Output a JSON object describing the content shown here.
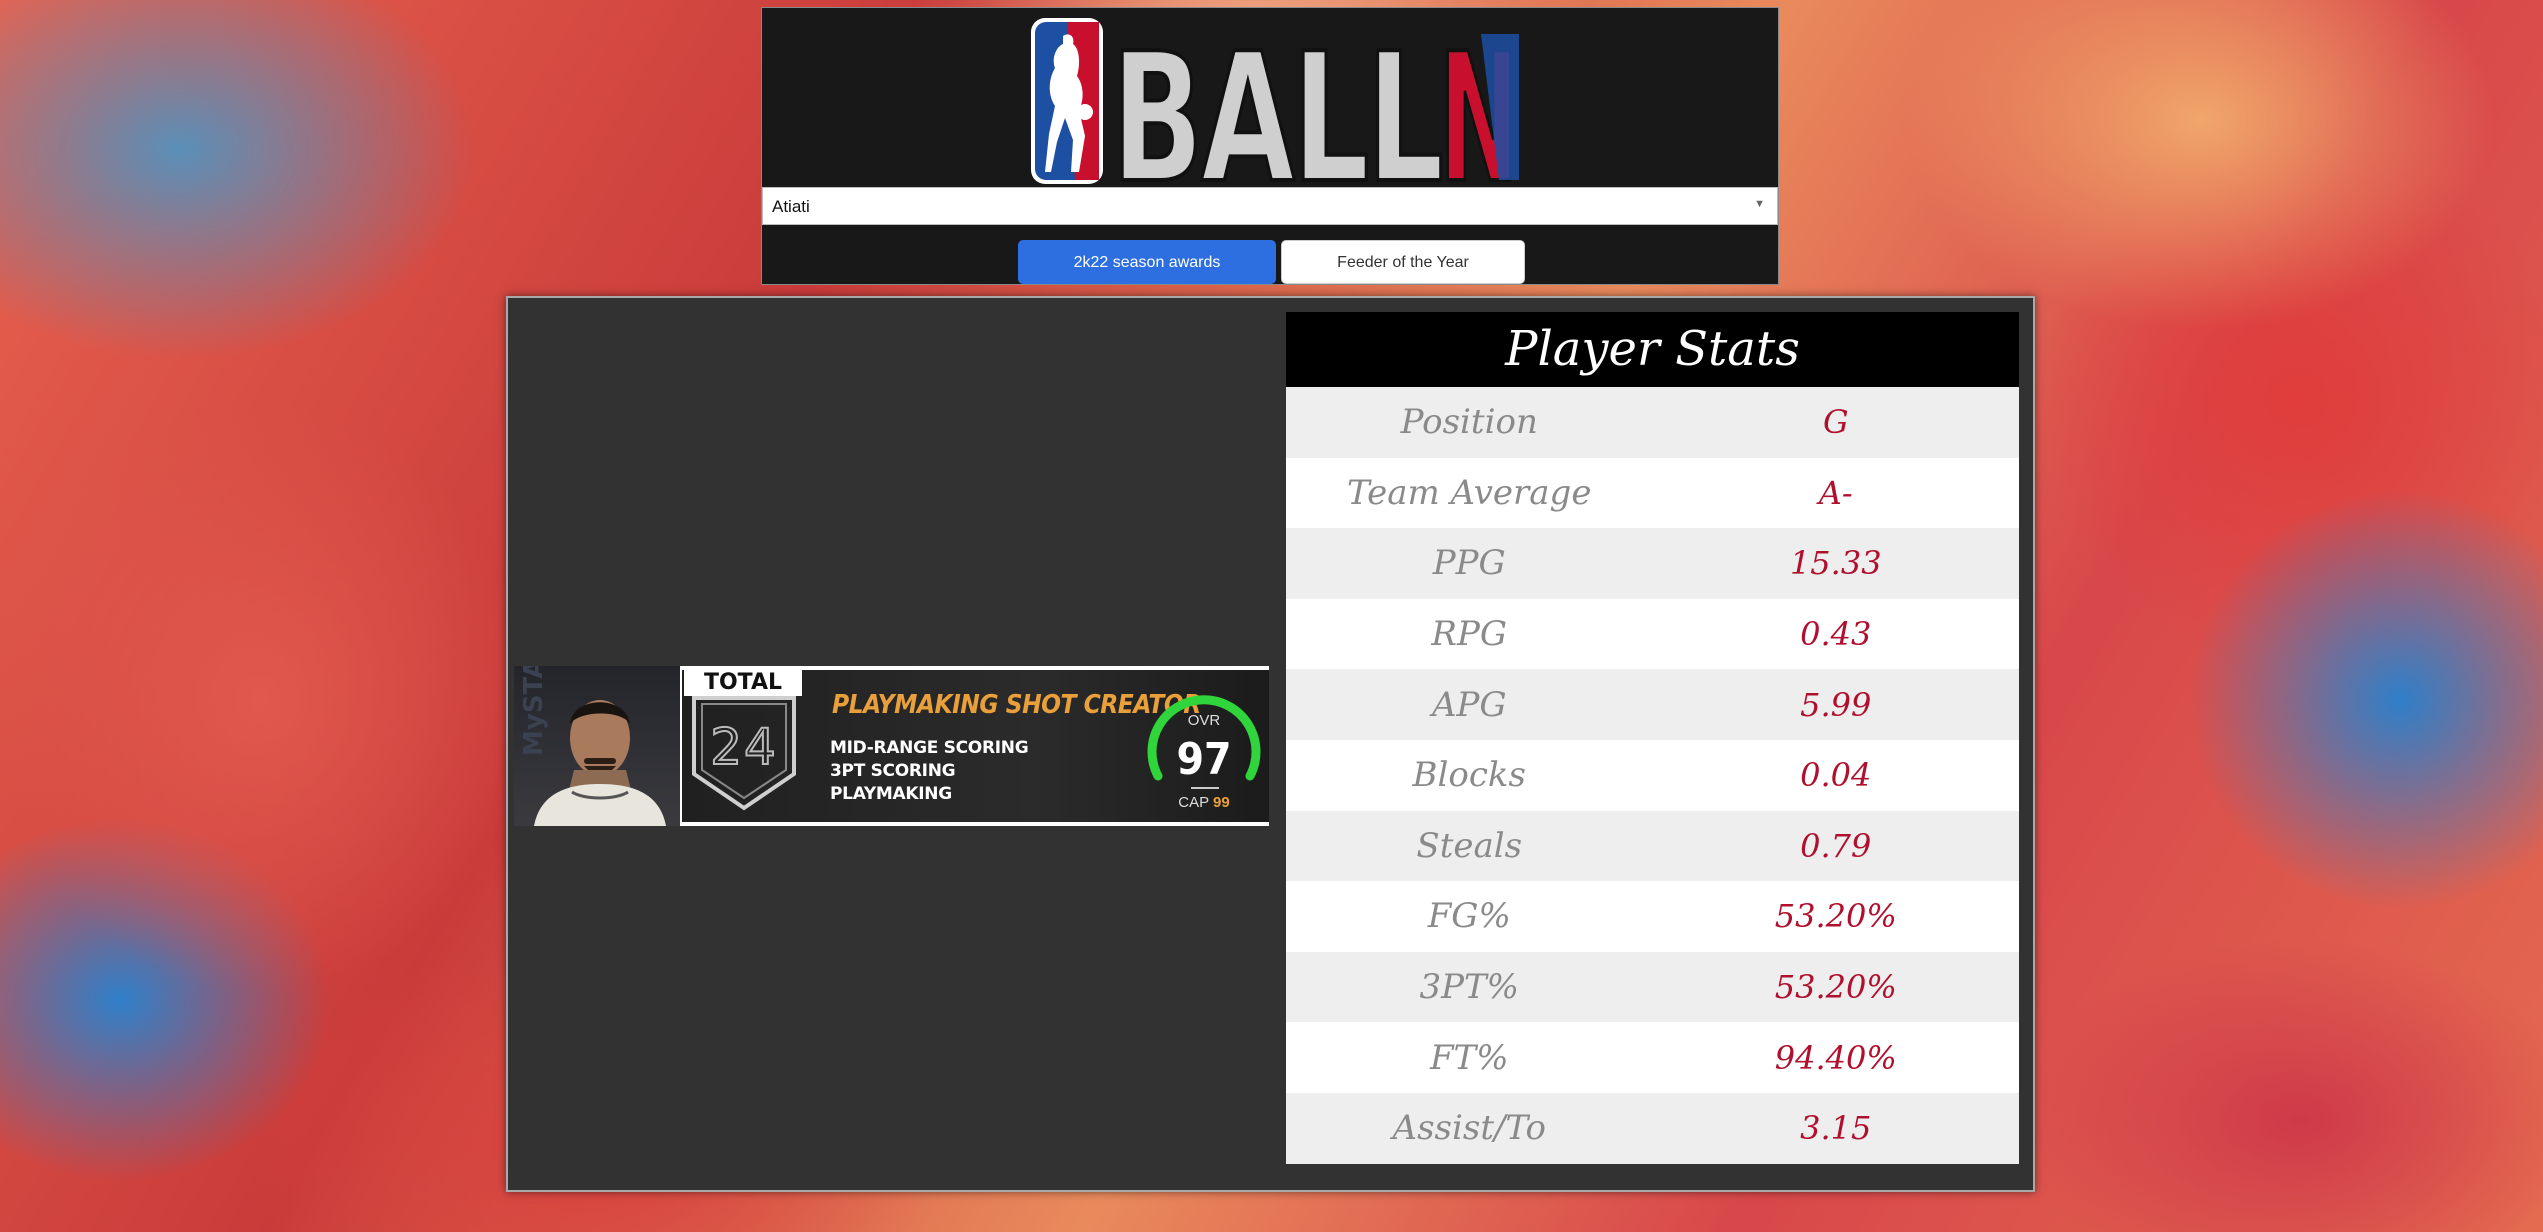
{
  "header": {
    "logo_text": "BALLN",
    "player_select": {
      "value": "Atiati"
    },
    "buttons": {
      "awards": "2k22 season awards",
      "feeder": "Feeder of the Year"
    }
  },
  "player_card": {
    "total_label": "TOTAL",
    "total_number": "24",
    "archetype": "PLAYMAKING SHOT CREATOR",
    "skills": [
      "MID-RANGE SCORING",
      "3PT SCORING",
      "PLAYMAKING"
    ],
    "ovr_label": "OVR",
    "ovr_value": "97",
    "cap_label": "CAP",
    "cap_value": "99",
    "watermark": "MySTATS"
  },
  "stats": {
    "title": "Player Stats",
    "rows": [
      {
        "label": "Position",
        "value": "G"
      },
      {
        "label": "Team Average",
        "value": "A-"
      },
      {
        "label": "PPG",
        "value": "15.33"
      },
      {
        "label": "RPG",
        "value": "0.43"
      },
      {
        "label": "APG",
        "value": "5.99"
      },
      {
        "label": "Blocks",
        "value": "0.04"
      },
      {
        "label": "Steals",
        "value": "0.79"
      },
      {
        "label": "FG%",
        "value": "53.20%"
      },
      {
        "label": "3PT%",
        "value": "53.20%"
      },
      {
        "label": "FT%",
        "value": "94.40%"
      },
      {
        "label": "Assist/To",
        "value": "3.15"
      }
    ]
  },
  "colors": {
    "accent_blue": "#2d6fe0",
    "stat_value": "#b0102e",
    "archetype_orange": "#e9a03a",
    "ovr_green": "#2fd53a"
  }
}
